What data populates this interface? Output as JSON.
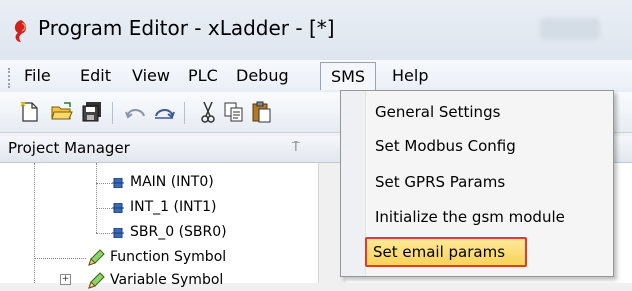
{
  "window": {
    "title": "Program Editor - xLadder - [*]",
    "app_icon": "xladder-logo-icon"
  },
  "menubar": {
    "items": [
      {
        "label": "File"
      },
      {
        "label": "Edit"
      },
      {
        "label": "View"
      },
      {
        "label": "PLC"
      },
      {
        "label": "Debug"
      },
      {
        "label": "SMS",
        "active": true
      },
      {
        "label": "Help"
      }
    ]
  },
  "toolbar": {
    "icons": [
      "new-file-icon",
      "open-folder-icon",
      "save-all-icon",
      "undo-icon",
      "redo-icon",
      "cut-icon",
      "copy-icon",
      "paste-icon"
    ]
  },
  "project_manager": {
    "title": "Project Manager",
    "pin_glyph": "⍑",
    "tree": [
      {
        "label": "MAIN (INT0)",
        "icon": "program-block-icon"
      },
      {
        "label": "INT_1 (INT1)",
        "icon": "program-block-icon"
      },
      {
        "label": "SBR_0 (SBR0)",
        "icon": "program-block-icon"
      },
      {
        "label": "Function Symbol",
        "icon": "pencil-icon"
      },
      {
        "label": "Variable Symbol",
        "icon": "pencil-icon"
      }
    ]
  },
  "sms_menu": {
    "items": [
      {
        "label": "General Settings"
      },
      {
        "label": "Set Modbus Config"
      },
      {
        "label": "Set GPRS Params"
      },
      {
        "label": "Initialize the gsm module"
      },
      {
        "label": "Set email params",
        "highlighted": true
      }
    ],
    "highlight_color": "#f9d35a",
    "highlight_border": "#e23a2e"
  }
}
